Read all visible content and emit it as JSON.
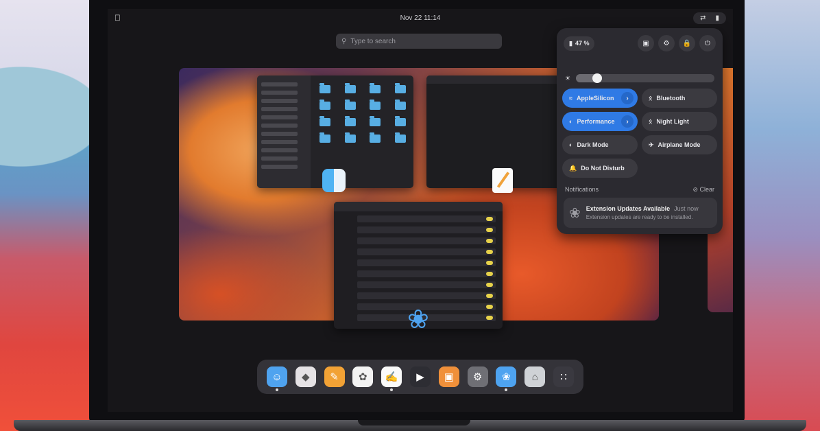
{
  "topbar": {
    "clock": "Nov 22  11:14"
  },
  "search": {
    "placeholder": "Type to search"
  },
  "quick_settings": {
    "battery": "47 %",
    "brightness_level": 0.12,
    "toggles": [
      {
        "id": "wifi",
        "label": "AppleSilicon",
        "on": true,
        "arrow": true
      },
      {
        "id": "bluetooth",
        "label": "Bluetooth",
        "on": false
      },
      {
        "id": "power",
        "label": "Performance",
        "on": true,
        "arrow": true
      },
      {
        "id": "night-light",
        "label": "Night Light",
        "on": false
      },
      {
        "id": "dark-mode",
        "label": "Dark Mode",
        "on": false
      },
      {
        "id": "airplane",
        "label": "Airplane Mode",
        "on": false
      },
      {
        "id": "dnd",
        "label": "Do Not Disturb",
        "on": false
      }
    ],
    "notifications_label": "Notifications",
    "clear_label": "Clear",
    "notification": {
      "title": "Extension Updates Available",
      "time": "Just now",
      "body": "Extension updates are ready to be installed."
    }
  },
  "dock": {
    "apps": [
      {
        "name": "finder",
        "color": "#4fa3ef",
        "running": true
      },
      {
        "name": "brave",
        "color": "#e5e2e5",
        "running": false
      },
      {
        "name": "notes",
        "color": "#f2a235",
        "running": false
      },
      {
        "name": "photos",
        "color": "#f3f3f3",
        "running": false
      },
      {
        "name": "text-editor",
        "color": "#fafafa",
        "running": true
      },
      {
        "name": "quicktime",
        "color": "#2d2d33",
        "running": false
      },
      {
        "name": "keynote",
        "color": "#f0903a",
        "running": false
      },
      {
        "name": "settings",
        "color": "#6f6f75",
        "running": false
      },
      {
        "name": "extensions",
        "color": "#4ea3f0",
        "running": true
      },
      {
        "name": "trash",
        "color": "#cfd2d6",
        "running": false
      },
      {
        "name": "app-grid",
        "color": "#3a3940",
        "running": false
      }
    ]
  }
}
